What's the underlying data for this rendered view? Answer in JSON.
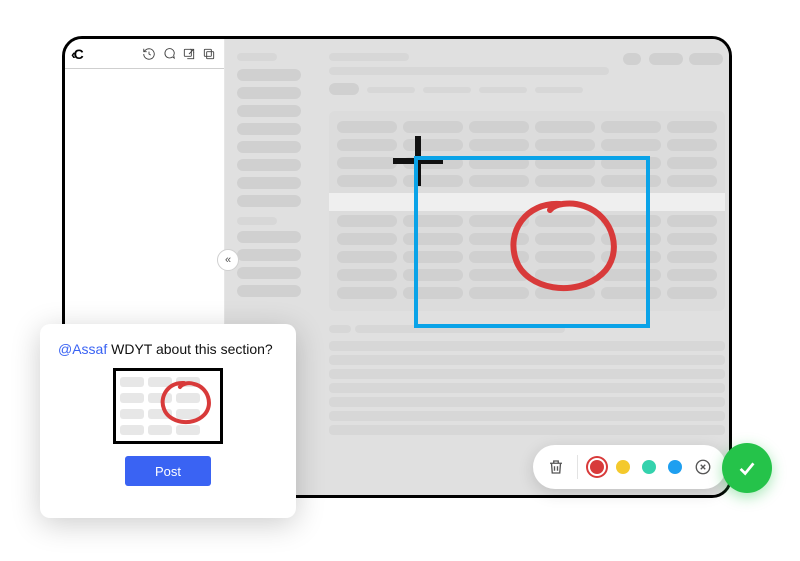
{
  "brand": "‹C",
  "sidebar": {
    "collapse_glyph": "«"
  },
  "comment": {
    "mention": "@Assaf",
    "body": " WDYT about this section?",
    "post_label": "Post"
  },
  "toolbar": {
    "colors": [
      {
        "name": "red",
        "hex": "#d83a3a",
        "selected": true
      },
      {
        "name": "yellow",
        "hex": "#f4c92c",
        "selected": false
      },
      {
        "name": "teal",
        "hex": "#34d2ad",
        "selected": false
      },
      {
        "name": "blue",
        "hex": "#1e9ff0",
        "selected": false
      }
    ],
    "confirm_hex": "#25c34a",
    "annotation_color": "#d83a3a",
    "selection_color": "#0aa3e8"
  }
}
